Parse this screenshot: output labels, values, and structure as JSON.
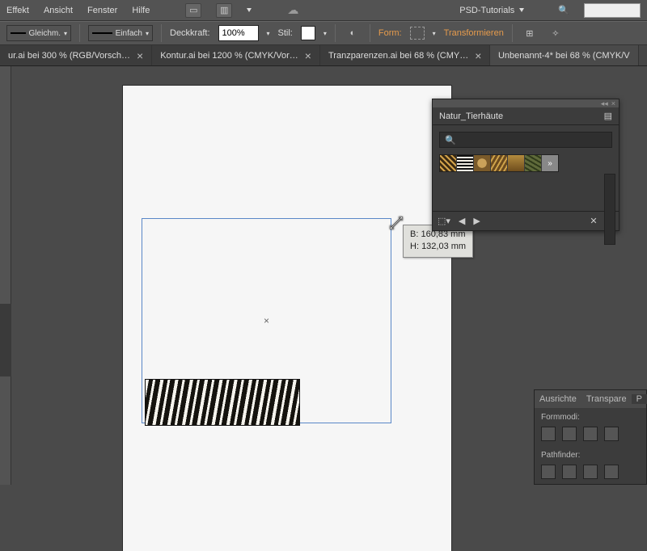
{
  "menu": {
    "effect": "Effekt",
    "view": "Ansicht",
    "window": "Fenster",
    "help": "Hilfe"
  },
  "top_right": {
    "psd_label": "PSD-Tutorials",
    "search_placeholder": ""
  },
  "options": {
    "stroke1": "Gleichm.",
    "stroke2": "Einfach",
    "opacity_label": "Deckkraft:",
    "opacity_value": "100%",
    "style_label": "Stil:",
    "shape_label": "Form:",
    "transform_label": "Transformieren"
  },
  "tabs": {
    "t0": "ur.ai bei 300 % (RGB/Vorsch…",
    "t1": "Kontur.ai bei 1200 % (CMYK/Vor…",
    "t2": "Tranzparenzen.ai bei 68 % (CMY…",
    "t3": "Unbenannt-4* bei 68 % (CMYK/V"
  },
  "dims": {
    "b_label": "B:",
    "b_value": "160,83 mm",
    "h_label": "H:",
    "h_value": "132,03 mm"
  },
  "swatches_panel": {
    "title": "Natur_Tierhäute"
  },
  "mini": {
    "tab1": "Ausrichte",
    "tab2": "Transpare",
    "tab3": "P",
    "formmodi": "Formmodi:",
    "pathfinder": "Pathfinder:"
  },
  "chart_data": null
}
